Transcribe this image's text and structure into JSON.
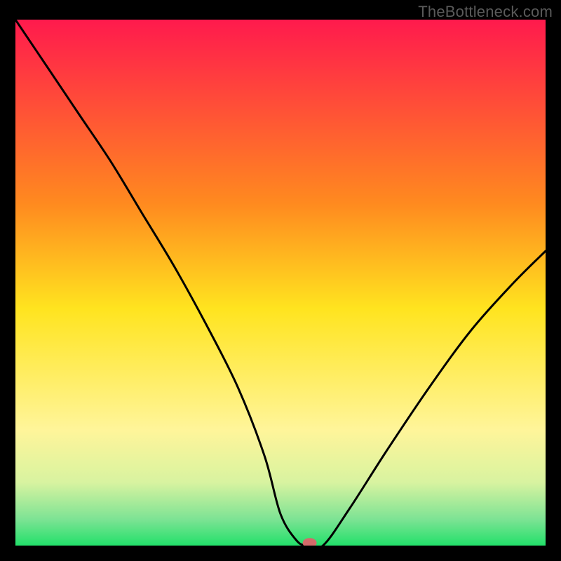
{
  "watermark": "TheBottleneck.com",
  "chart_data": {
    "type": "line",
    "title": "",
    "xlabel": "",
    "ylabel": "",
    "xlim": [
      0,
      100
    ],
    "ylim": [
      0,
      100
    ],
    "gradient_stops": [
      {
        "offset": 0,
        "color": "#ff1a4d"
      },
      {
        "offset": 35,
        "color": "#ff8a1f"
      },
      {
        "offset": 55,
        "color": "#ffe41f"
      },
      {
        "offset": 78,
        "color": "#fff59a"
      },
      {
        "offset": 88,
        "color": "#d8f3a0"
      },
      {
        "offset": 95,
        "color": "#7de394"
      },
      {
        "offset": 100,
        "color": "#22e06a"
      }
    ],
    "series": [
      {
        "name": "bottleneck-curve",
        "x": [
          0,
          6,
          12,
          18,
          24,
          30,
          36,
          42,
          47,
          50,
          53,
          55,
          58,
          63,
          70,
          78,
          86,
          94,
          100
        ],
        "y": [
          100,
          91,
          82,
          73,
          63,
          53,
          42,
          30,
          17,
          6,
          1,
          0,
          0,
          7,
          18,
          30,
          41,
          50,
          56
        ]
      }
    ],
    "marker": {
      "x": 55.5,
      "y": 0.5,
      "color": "#d46a6a"
    }
  }
}
